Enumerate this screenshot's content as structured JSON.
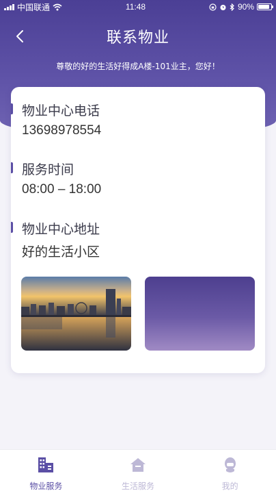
{
  "status_bar": {
    "carrier": "中国联通",
    "time": "11:48",
    "battery": "90%"
  },
  "header": {
    "title": "联系物业",
    "greeting": "尊敬的好的生活好得成A楼-101业主，您好！"
  },
  "card": {
    "phone": {
      "label": "物业中心电话",
      "value": "13698978554"
    },
    "hours": {
      "label": "服务时间",
      "value": "08:00 – 18:00"
    },
    "address": {
      "label": "物业中心地址",
      "value": "好的生活小区"
    }
  },
  "tabs": [
    {
      "label": "物业服务",
      "icon": "building-icon",
      "active": true
    },
    {
      "label": "生活服务",
      "icon": "home-icon",
      "active": false
    },
    {
      "label": "我的",
      "icon": "user-icon",
      "active": false
    }
  ],
  "colors": {
    "primary": "#5b4fa5",
    "header_top": "#4b3f95",
    "tab_inactive": "#bdb8d6"
  }
}
